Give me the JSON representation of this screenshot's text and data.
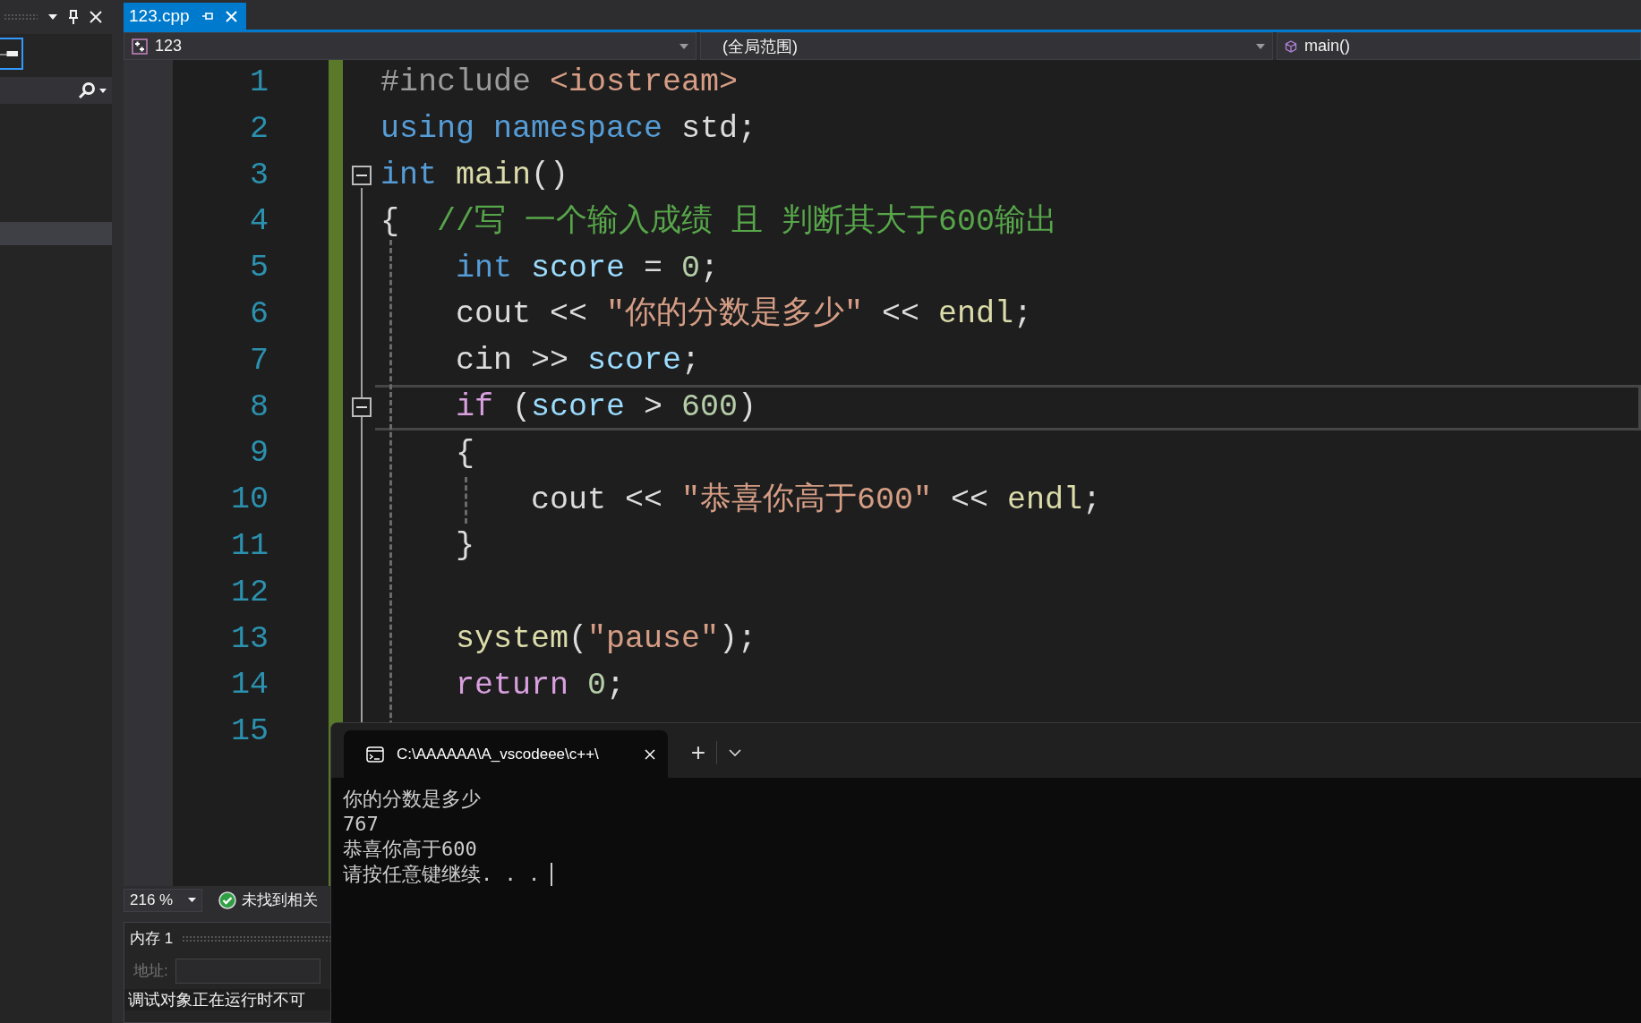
{
  "tabs": [
    {
      "label": "123.cpp",
      "selected": true
    }
  ],
  "nav_bar": {
    "project": "123",
    "scope": "(全局范围)",
    "member": "main()"
  },
  "code_lines": [
    {
      "number": "1",
      "foldable": false,
      "current": false,
      "tokens": [
        {
          "kind": "pre",
          "text": "#include "
        },
        {
          "kind": "str",
          "text": "<iostream>"
        }
      ]
    },
    {
      "number": "2",
      "foldable": false,
      "current": false,
      "tokens": [
        {
          "kind": "kw",
          "text": "using"
        },
        {
          "kind": "kw",
          "text": " namespace"
        },
        {
          "kind": "plain",
          "text": " std;"
        }
      ]
    },
    {
      "number": "3",
      "foldable": true,
      "current": false,
      "tokens": [
        {
          "kind": "kw",
          "text": "int"
        },
        {
          "kind": "fn",
          "text": " main"
        },
        {
          "kind": "plain",
          "text": "()"
        }
      ]
    },
    {
      "number": "4",
      "foldable": false,
      "current": false,
      "tokens": [
        {
          "kind": "plain",
          "text": "{  "
        },
        {
          "kind": "comment",
          "text": "//写 一个输入成绩 且 判断其大于600输出"
        }
      ]
    },
    {
      "number": "5",
      "foldable": false,
      "current": false,
      "tokens": [
        {
          "kind": "kw",
          "text": "    int"
        },
        {
          "kind": "var",
          "text": " score"
        },
        {
          "kind": "plain",
          "text": " = "
        },
        {
          "kind": "num",
          "text": "0"
        },
        {
          "kind": "plain",
          "text": ";"
        }
      ]
    },
    {
      "number": "6",
      "foldable": false,
      "current": false,
      "tokens": [
        {
          "kind": "plain",
          "text": "    cout << "
        },
        {
          "kind": "str",
          "text": "\"你的分数是多少\""
        },
        {
          "kind": "plain",
          "text": " << "
        },
        {
          "kind": "fn",
          "text": "endl"
        },
        {
          "kind": "plain",
          "text": ";"
        }
      ]
    },
    {
      "number": "7",
      "foldable": false,
      "current": false,
      "tokens": [
        {
          "kind": "plain",
          "text": "    cin >> "
        },
        {
          "kind": "var",
          "text": "score"
        },
        {
          "kind": "plain",
          "text": ";"
        }
      ]
    },
    {
      "number": "8",
      "foldable": true,
      "current": true,
      "tokens": [
        {
          "kind": "ctl",
          "text": "    if"
        },
        {
          "kind": "plain",
          "text": " ("
        },
        {
          "kind": "var",
          "text": "score"
        },
        {
          "kind": "plain",
          "text": " > "
        },
        {
          "kind": "num",
          "text": "600"
        },
        {
          "kind": "plain",
          "text": ")"
        }
      ]
    },
    {
      "number": "9",
      "foldable": false,
      "current": false,
      "tokens": [
        {
          "kind": "plain",
          "text": "    {"
        }
      ]
    },
    {
      "number": "10",
      "foldable": false,
      "current": false,
      "tokens": [
        {
          "kind": "plain",
          "text": "        cout << "
        },
        {
          "kind": "str",
          "text": "\"恭喜你高于600\""
        },
        {
          "kind": "plain",
          "text": " << "
        },
        {
          "kind": "fn",
          "text": "endl"
        },
        {
          "kind": "plain",
          "text": ";"
        }
      ]
    },
    {
      "number": "11",
      "foldable": false,
      "current": false,
      "tokens": [
        {
          "kind": "plain",
          "text": "    }"
        }
      ]
    },
    {
      "number": "12",
      "foldable": false,
      "current": false
    },
    {
      "number": "13",
      "foldable": false,
      "current": false,
      "tokens": [
        {
          "kind": "fn",
          "text": "    system"
        },
        {
          "kind": "plain",
          "text": "("
        },
        {
          "kind": "str",
          "text": "\"pause\""
        },
        {
          "kind": "plain",
          "text": ");"
        }
      ]
    },
    {
      "number": "14",
      "foldable": false,
      "current": false,
      "tokens": [
        {
          "kind": "ctl",
          "text": "    return"
        },
        {
          "kind": "num",
          "text": " 0"
        },
        {
          "kind": "plain",
          "text": ";"
        }
      ]
    },
    {
      "number": "15",
      "foldable": false,
      "current": false
    }
  ],
  "status_bar": {
    "zoom": "216 %",
    "issues": "未找到相关"
  },
  "memory_panel": {
    "title": "内存 1",
    "address_label": "地址:",
    "message": "调试对象正在运行时不可"
  },
  "terminal": {
    "tabs": [
      {
        "title": "C:\\AAAAAA\\A_vscodeee\\c++\\",
        "selected": true
      }
    ],
    "new_tab": "+",
    "output": [
      "你的分数是多少",
      "767",
      "恭喜你高于600",
      "请按任意键继续. . ."
    ]
  }
}
